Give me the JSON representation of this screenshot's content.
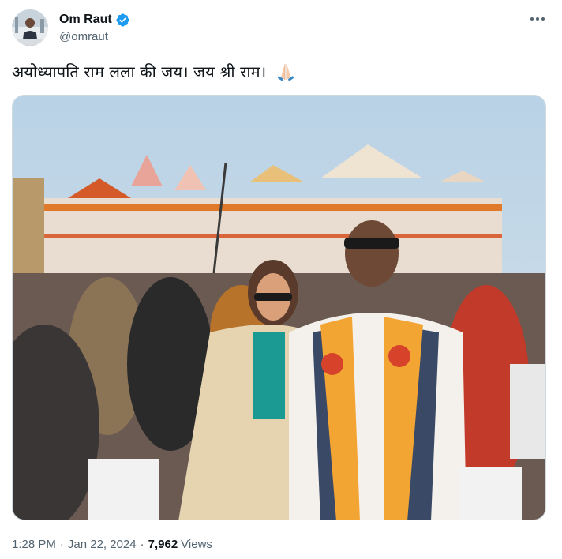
{
  "author": {
    "display_name": "Om Raut",
    "handle": "@omraut",
    "verified": true,
    "avatar_icon": "profile-photo"
  },
  "tweet": {
    "text": "अयोध्यापति राम लला की जय। जय श्री राम।",
    "emoji": "folded-hands-icon"
  },
  "meta": {
    "time": "1:28 PM",
    "separator": "·",
    "date": "Jan 22, 2024",
    "views_count": "7,962",
    "views_label": "Views"
  },
  "colors": {
    "verified_blue": "#1d9bf0",
    "text_primary": "#0f1419",
    "text_secondary": "#536471",
    "border": "#cfd9de"
  }
}
